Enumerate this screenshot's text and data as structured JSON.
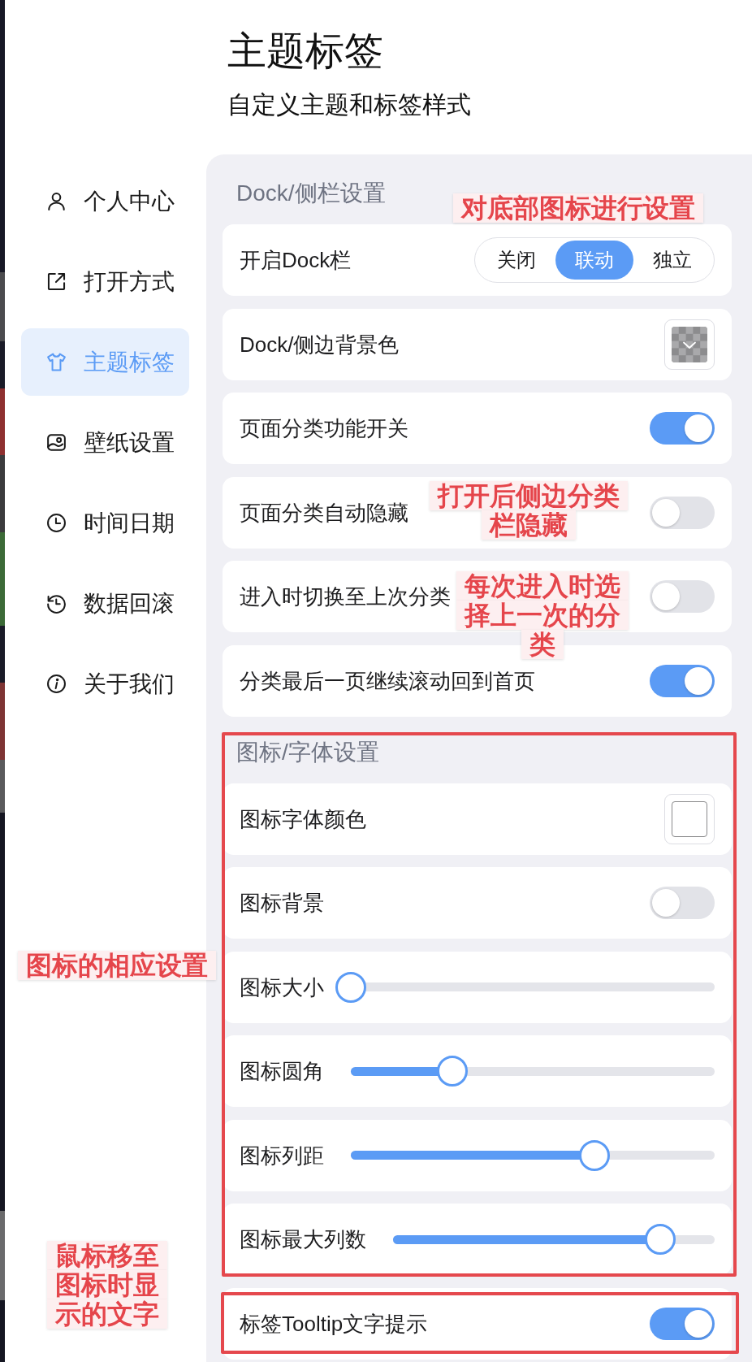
{
  "header": {
    "title": "主题标签",
    "subtitle": "自定义主题和标签样式"
  },
  "sidebar": {
    "items": [
      {
        "label": "个人中心",
        "selected": false
      },
      {
        "label": "打开方式",
        "selected": false
      },
      {
        "label": "主题标签",
        "selected": true
      },
      {
        "label": "壁纸设置",
        "selected": false
      },
      {
        "label": "时间日期",
        "selected": false
      },
      {
        "label": "数据回滚",
        "selected": false
      },
      {
        "label": "关于我们",
        "selected": false
      }
    ]
  },
  "sections": [
    {
      "title": "Dock/侧栏设置",
      "rows": [
        {
          "kind": "segmented",
          "label": "开启Dock栏",
          "options": [
            {
              "label": "关闭",
              "selected": false
            },
            {
              "label": "联动",
              "selected": true
            },
            {
              "label": "独立",
              "selected": false
            }
          ]
        },
        {
          "kind": "color",
          "label": "Dock/侧边背景色",
          "transparent": true
        },
        {
          "kind": "toggle",
          "label": "页面分类功能开关",
          "on": true
        },
        {
          "kind": "toggle",
          "label": "页面分类自动隐藏",
          "on": false
        },
        {
          "kind": "toggle",
          "label": "进入时切换至上次分类",
          "on": false
        },
        {
          "kind": "toggle",
          "label": "分类最后一页继续滚动回到首页",
          "on": true
        }
      ]
    },
    {
      "title": "图标/字体设置",
      "rows": [
        {
          "kind": "color",
          "label": "图标字体颜色",
          "transparent": false,
          "color": "#ffffff"
        },
        {
          "kind": "toggle",
          "label": "图标背景",
          "on": false
        },
        {
          "kind": "slider",
          "label": "图标大小",
          "level": 0
        },
        {
          "kind": "slider",
          "label": "图标圆角",
          "level": 0.28
        },
        {
          "kind": "slider",
          "label": "图标列距",
          "level": 0.67
        },
        {
          "kind": "slider",
          "label": "图标最大列数",
          "level": 0.83
        },
        {
          "kind": "toggle",
          "label": "标签Tooltip文字提示",
          "on": true
        }
      ]
    }
  ],
  "annotations": [
    {
      "kind": "note",
      "text": "对底部图标进行设置"
    },
    {
      "kind": "note",
      "text": "打开后侧边分类栏隐藏"
    },
    {
      "kind": "note",
      "text": "每次进入时选择上一次的分类"
    },
    {
      "kind": "note",
      "text": "图标的相应设置"
    },
    {
      "kind": "note",
      "text": "鼠标移至图标时显示的文字"
    },
    {
      "kind": "frame"
    },
    {
      "kind": "frame"
    }
  ]
}
